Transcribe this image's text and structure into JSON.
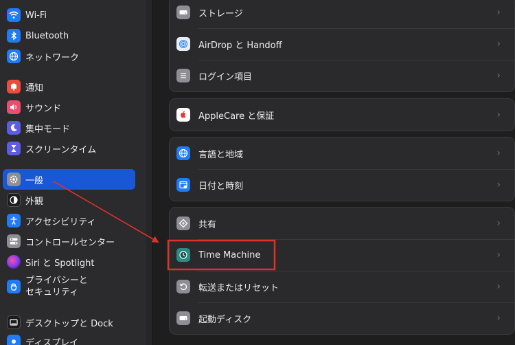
{
  "sidebar": {
    "items": [
      {
        "label": "Wi-Fi"
      },
      {
        "label": "Bluetooth"
      },
      {
        "label": "ネットワーク"
      },
      {
        "label": "通知"
      },
      {
        "label": "サウンド"
      },
      {
        "label": "集中モード"
      },
      {
        "label": "スクリーンタイム"
      },
      {
        "label": "一般"
      },
      {
        "label": "外観"
      },
      {
        "label": "アクセシビリティ"
      },
      {
        "label": "コントロールセンター"
      },
      {
        "label": "Siri と Spotlight"
      },
      {
        "label_line1": "プライバシーと",
        "label_line2": "セキュリティ"
      },
      {
        "label": "デスクトップと Dock"
      },
      {
        "label": "ディスプレイ"
      }
    ],
    "selected": "一般"
  },
  "main": {
    "group1": [
      {
        "label": "ストレージ"
      },
      {
        "label": "AirDrop と Handoff"
      },
      {
        "label": "ログイン項目"
      }
    ],
    "group2": [
      {
        "label": "AppleCare と保証"
      }
    ],
    "group3": [
      {
        "label": "言語と地域"
      },
      {
        "label": "日付と時刻"
      }
    ],
    "group4": [
      {
        "label": "共有"
      },
      {
        "label": "Time Machine"
      },
      {
        "label": "転送またはリセット"
      },
      {
        "label": "起動ディスク"
      }
    ]
  },
  "chevron": "›",
  "colors": {
    "selection": "#1a57d6",
    "annotation": "#e0302a"
  }
}
